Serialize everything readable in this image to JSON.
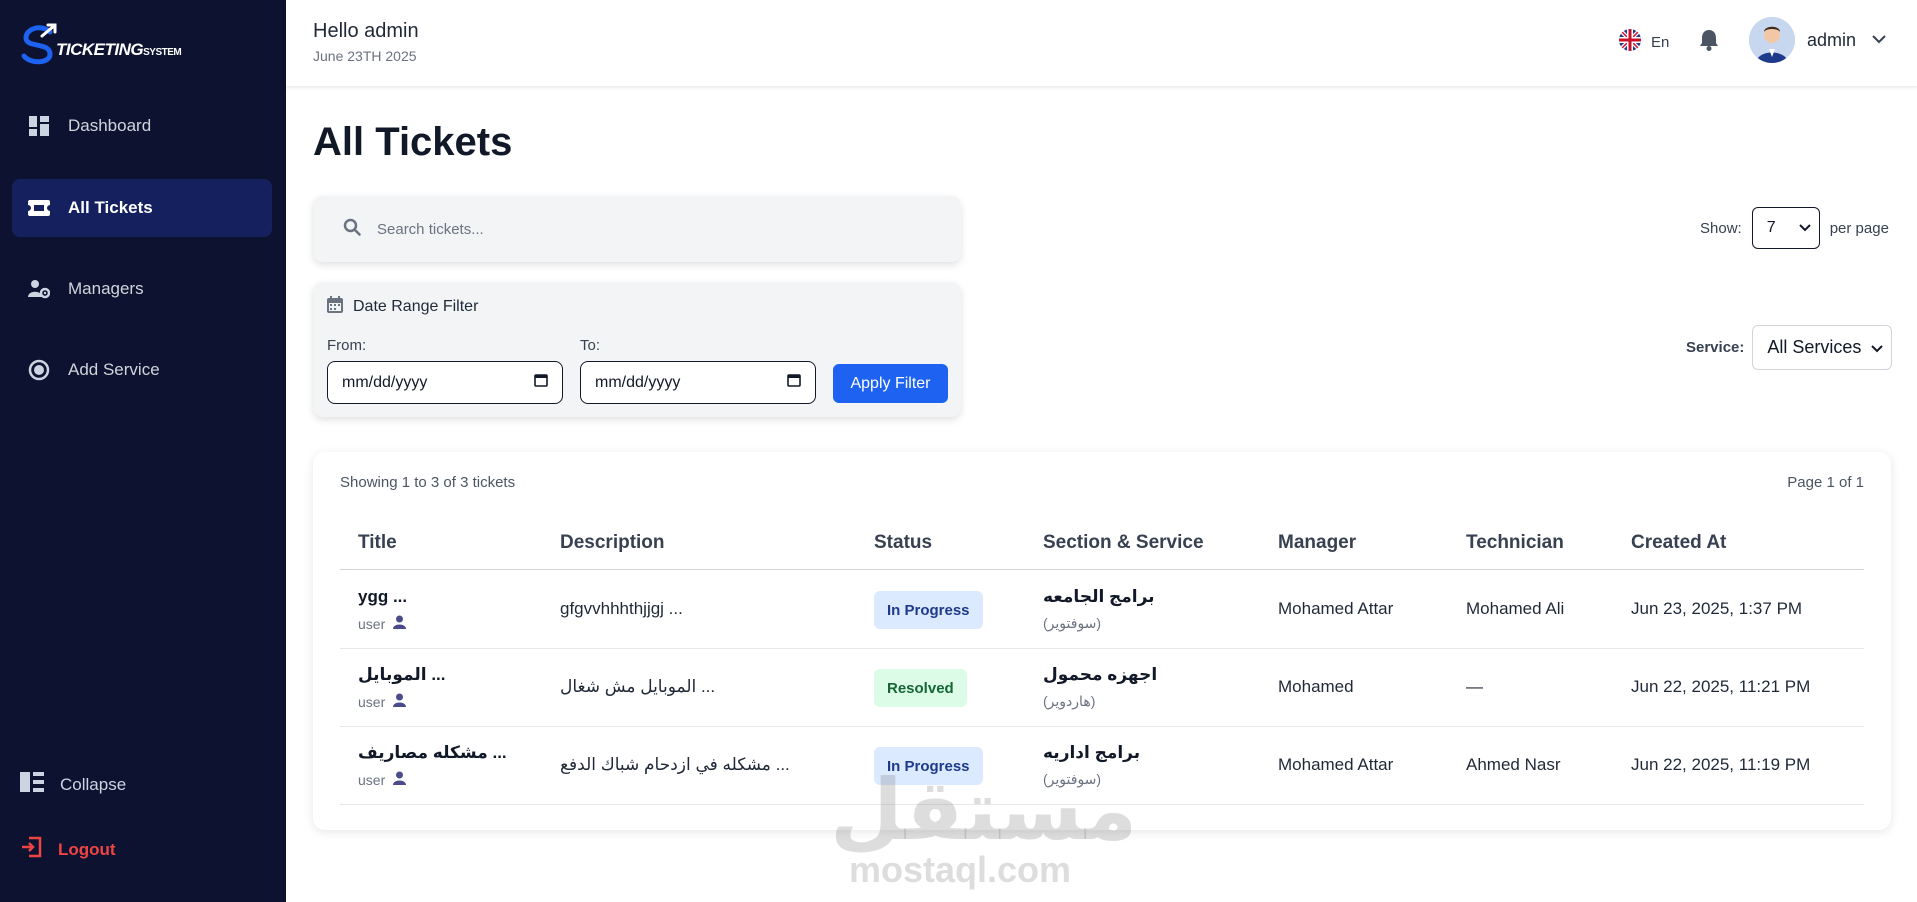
{
  "sidebar": {
    "logo": {
      "text": "TICKETING",
      "suffix": "SYSTEM"
    },
    "items": [
      {
        "label": "Dashboard",
        "icon": "dashboard-icon"
      },
      {
        "label": "All Tickets",
        "icon": "ticket-icon",
        "active": true
      },
      {
        "label": "Managers",
        "icon": "user-gear-icon"
      },
      {
        "label": "Add Service",
        "icon": "circle-dot-icon"
      }
    ],
    "collapse_label": "Collapse",
    "logout_label": "Logout"
  },
  "header": {
    "greeting": "Hello admin",
    "date": "June 23TH 2025",
    "language": "En",
    "username": "admin"
  },
  "page": {
    "title": "All Tickets",
    "search": {
      "placeholder": "Search tickets..."
    },
    "show": {
      "label": "Show:",
      "value": "7",
      "suffix": "per page"
    },
    "date_filter": {
      "title": "Date Range Filter",
      "from_label": "From:",
      "to_label": "To:",
      "from_value": "mm/dd/yyyy",
      "to_value": "mm/dd/yyyy",
      "apply_label": "Apply Filter"
    },
    "service": {
      "label": "Service:",
      "value": "All Services"
    }
  },
  "table": {
    "showing": "Showing 1 to 3 of 3 tickets",
    "page_info": "Page 1 of 1",
    "headers": [
      "Title",
      "Description",
      "Status",
      "Section & Service",
      "Manager",
      "Technician",
      "Created At"
    ],
    "rows": [
      {
        "title": "ygg ...",
        "user": "user",
        "description": "gfgvvhhhthjjgj ...",
        "status": "In Progress",
        "status_type": "progress",
        "section": "برامج الجامعه",
        "service": "(سوفتوير)",
        "manager": "Mohamed Attar",
        "technician": "Mohamed Ali",
        "created_at": "Jun 23, 2025, 1:37 PM"
      },
      {
        "title": "الموبايل ...",
        "user": "user",
        "description": "الموبايل مش شغال ...",
        "status": "Resolved",
        "status_type": "resolved",
        "section": "اجهزه محمول",
        "service": "(هاردوير)",
        "manager": "Mohamed",
        "technician": "—",
        "created_at": "Jun 22, 2025, 11:21 PM"
      },
      {
        "title": "مشكله مصاريف ...",
        "user": "user",
        "description": "مشكله في ازدحام شباك الدفع ...",
        "status": "In Progress",
        "status_type": "progress",
        "section": "برامج اداريه",
        "service": "(سوفتوير)",
        "manager": "Mohamed Attar",
        "technician": "Ahmed Nasr",
        "created_at": "Jun 22, 2025, 11:19 PM"
      }
    ]
  },
  "watermark": {
    "arabic": "مستقل",
    "latin": "mostaql.com"
  },
  "colors": {
    "sidebar_bg": "#0c1230",
    "active_item": "#15215e",
    "primary": "#1d62f0",
    "logout": "#ef4444",
    "in_progress_bg": "#dbeafe",
    "resolved_bg": "#dcfce7"
  }
}
